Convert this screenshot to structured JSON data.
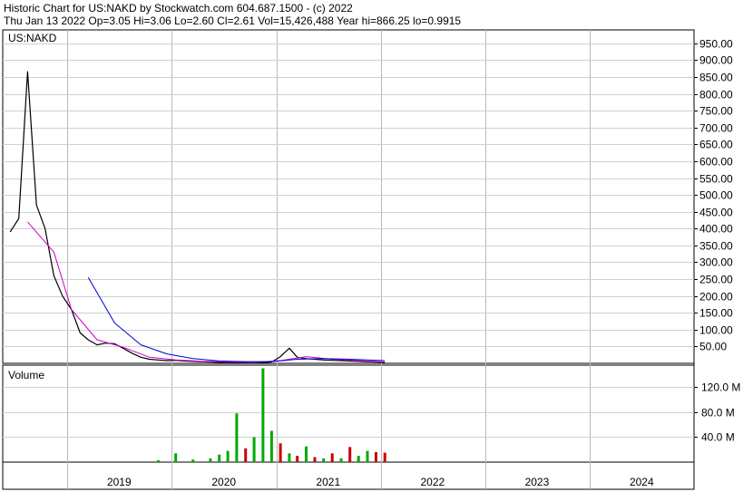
{
  "header": {
    "line1": "Historic Chart for US:NAKD by Stockwatch.com 604.687.1500 - (c) 2022",
    "line2": "Thu Jan 13 2022   Op=3.05   Hi=3.06   Lo=2.60   Cl=2.61   Vol=15,426,488   Year hi=866.25   lo=0.9915"
  },
  "chart_data": [
    {
      "type": "line",
      "title": "US:NAKD",
      "ylim": [
        0,
        990
      ],
      "y_ticks": [
        50,
        100,
        150,
        200,
        250,
        300,
        350,
        400,
        450,
        500,
        550,
        600,
        650,
        700,
        750,
        800,
        850,
        900,
        950
      ],
      "y_tick_labels": [
        "50.00",
        "100.00",
        "150.00",
        "200.00",
        "250.00",
        "300.00",
        "350.00",
        "400.00",
        "450.00",
        "500.00",
        "550.00",
        "600.00",
        "650.00",
        "700.00",
        "750.00",
        "800.00",
        "850.00",
        "900.00",
        "950.00"
      ],
      "x_labels": [
        "2019",
        "2020",
        "2021",
        "2022",
        "2023",
        "2024"
      ],
      "grid": true,
      "series": [
        {
          "role": "price",
          "color": "#000000",
          "x": [
            "2018-06",
            "2018-07",
            "2018-08",
            "2018-09",
            "2018-10",
            "2018-11",
            "2018-12",
            "2019-01",
            "2019-02",
            "2019-03",
            "2019-04",
            "2019-05",
            "2019-06",
            "2019-07",
            "2019-08",
            "2019-09",
            "2019-10",
            "2019-11",
            "2019-12",
            "2020-01",
            "2020-02",
            "2020-03",
            "2020-04",
            "2020-05",
            "2020-06",
            "2020-07",
            "2020-08",
            "2020-09",
            "2020-10",
            "2020-11",
            "2020-12",
            "2021-01",
            "2021-02",
            "2021-03",
            "2021-04",
            "2021-05",
            "2021-06",
            "2021-07",
            "2021-08",
            "2021-09",
            "2021-10",
            "2021-11",
            "2021-12",
            "2022-01"
          ],
          "values": [
            390,
            430,
            866,
            470,
            400,
            260,
            200,
            160,
            90,
            70,
            55,
            60,
            58,
            45,
            30,
            18,
            12,
            10,
            8,
            9,
            7,
            6,
            5,
            4,
            3,
            3,
            2.5,
            2.5,
            2.2,
            2.5,
            4,
            20,
            45,
            18,
            14,
            12,
            10,
            9,
            8,
            7,
            6,
            5,
            4,
            2.61
          ]
        },
        {
          "role": "moving average (short)",
          "color": "#cc00cc",
          "x": [
            "2018-08",
            "2018-11",
            "2019-01",
            "2019-04",
            "2019-07",
            "2019-10",
            "2020-01",
            "2020-04",
            "2020-07",
            "2020-10",
            "2021-01",
            "2021-04",
            "2021-07",
            "2021-10",
            "2022-01"
          ],
          "values": [
            420,
            330,
            160,
            70,
            48,
            18,
            10,
            6,
            4,
            3,
            8,
            20,
            12,
            8,
            4
          ]
        },
        {
          "role": "moving average (long)",
          "color": "#0000cc",
          "x": [
            "2019-03",
            "2019-06",
            "2019-09",
            "2019-12",
            "2020-03",
            "2020-06",
            "2020-09",
            "2020-12",
            "2021-03",
            "2021-06",
            "2021-09",
            "2022-01"
          ],
          "values": [
            255,
            120,
            55,
            28,
            14,
            7,
            5,
            5,
            12,
            14,
            12,
            8
          ]
        }
      ]
    },
    {
      "type": "bar",
      "title": "Volume",
      "ylim": [
        0,
        155
      ],
      "y_ticks": [
        40,
        80,
        120
      ],
      "y_tick_labels": [
        "40.0 M",
        "80.0 M",
        "120.0 M"
      ],
      "up_color": "#00aa00",
      "down_color": "#cc0000",
      "x": [
        "2019-11",
        "2020-01",
        "2020-03",
        "2020-05",
        "2020-06",
        "2020-07",
        "2020-08",
        "2020-09",
        "2020-10",
        "2020-11",
        "2020-12",
        "2021-01",
        "2021-02",
        "2021-03",
        "2021-04",
        "2021-05",
        "2021-06",
        "2021-07",
        "2021-08",
        "2021-09",
        "2021-10",
        "2021-11",
        "2021-12",
        "2022-01"
      ],
      "values": [
        3,
        14,
        4,
        6,
        12,
        18,
        78,
        22,
        40,
        150,
        50,
        30,
        14,
        10,
        25,
        8,
        6,
        14,
        6,
        24,
        10,
        18,
        16,
        15
      ],
      "up": [
        true,
        true,
        true,
        true,
        true,
        true,
        true,
        false,
        true,
        true,
        true,
        false,
        true,
        false,
        true,
        false,
        true,
        false,
        true,
        false,
        true,
        true,
        false,
        false
      ]
    }
  ]
}
